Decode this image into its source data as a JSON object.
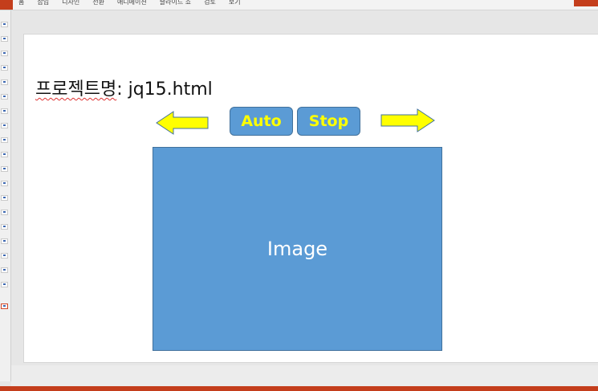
{
  "ribbon": {
    "tabs": [
      {
        "label": "홈"
      },
      {
        "label": "삽입"
      },
      {
        "label": "디자인"
      },
      {
        "label": "전환"
      },
      {
        "label": "애니메이션"
      },
      {
        "label": "슬라이드 쇼"
      },
      {
        "label": "검토"
      },
      {
        "label": "보기"
      }
    ]
  },
  "slide": {
    "title_prefix": "프로젝트명",
    "title_suffix": ": jq15.html",
    "auto_button": "Auto",
    "stop_button": "Stop",
    "image_label": "Image",
    "left_arrow_icon": "left-arrow-icon",
    "right_arrow_icon": "right-arrow-icon"
  },
  "colors": {
    "shape_fill": "#5b9bd5",
    "shape_border": "#41719c",
    "button_text": "#ffff00",
    "arrow_fill": "#ffff00",
    "accent": "#c43e1c"
  }
}
